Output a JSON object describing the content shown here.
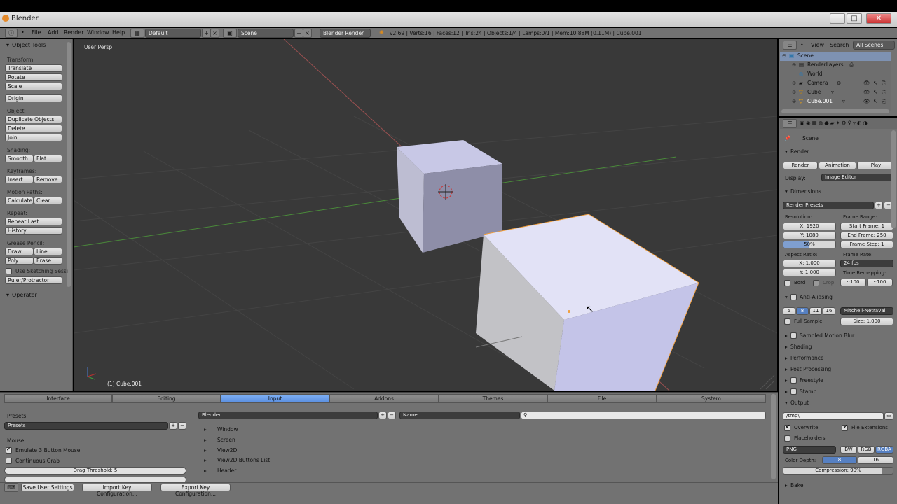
{
  "window": {
    "title": "Blender",
    "minimize": "─",
    "maximize": "□",
    "close": "✕"
  },
  "menubar": {
    "items": [
      "File",
      "Add",
      "Render",
      "Window",
      "Help"
    ],
    "layout": "Default",
    "scene": "Scene",
    "engine": "Blender Render",
    "stats": "v2.69 | Verts:16 | Faces:12 | Tris:24 | Objects:1/4 | Lamps:0/1 | Mem:10.88M (0.11M) | Cube.001"
  },
  "toolbar": {
    "panel_title": "Object Tools",
    "transform_label": "Transform:",
    "translate": "Translate",
    "rotate": "Rotate",
    "scale": "Scale",
    "origin": "Origin",
    "object_label": "Object:",
    "duplicate": "Duplicate Objects",
    "delete": "Delete",
    "join": "Join",
    "shading_label": "Shading:",
    "smooth": "Smooth",
    "flat": "Flat",
    "keyframes_label": "Keyframes:",
    "insert": "Insert",
    "remove": "Remove",
    "motion_label": "Motion Paths:",
    "calculate": "Calculate",
    "clear": "Clear",
    "repeat_label": "Repeat:",
    "repeat_last": "Repeat Last",
    "history": "History...",
    "grease_label": "Grease Pencil:",
    "draw": "Draw",
    "line": "Line",
    "poly": "Poly",
    "erase": "Erase",
    "use_sketching": "Use Sketching Sessi",
    "ruler": "Ruler/Protractor",
    "operator": "Operator"
  },
  "viewport": {
    "view_label": "User Persp",
    "object_label": "(1) Cube.001"
  },
  "outliner": {
    "view": "View",
    "search": "Search",
    "filter": "All Scenes",
    "items": [
      "Scene",
      "RenderLayers",
      "World",
      "Camera",
      "Cube",
      "Cube.001"
    ]
  },
  "properties": {
    "context": "Scene",
    "render_title": "Render",
    "render_btn": "Render",
    "animation_btn": "Animation",
    "play_btn": "Play",
    "display_label": "Display:",
    "display_value": "Image Editor",
    "dimensions_title": "Dimensions",
    "presets": "Render Presets",
    "resolution_label": "Resolution:",
    "res_x": "X: 1920",
    "res_y": "Y: 1080",
    "res_pct": "50%",
    "frame_range_label": "Frame Range:",
    "start_frame": "Start Frame: 1",
    "end_frame": "End Frame: 250",
    "frame_step": "Frame Step: 1",
    "aspect_label": "Aspect Ratio:",
    "aspect_x": "X: 1.000",
    "aspect_y": "Y: 1.000",
    "frame_rate_label": "Frame Rate:",
    "frame_rate": "24 fps",
    "time_remap_label": "Time Remapping:",
    "remap_old": "·:100",
    "remap_new": "·:100",
    "bord": "Bord",
    "crop": "Crop",
    "aa_title": "Anti-Aliasing",
    "aa_samples": [
      "5",
      "8",
      "11",
      "16"
    ],
    "aa_filter": "Mitchell-Netravali",
    "full_sample": "Full Sample",
    "aa_size": "Size: 1.000",
    "sampled_motion_blur": "Sampled Motion Blur",
    "shading": "Shading",
    "performance": "Performance",
    "post_processing": "Post Processing",
    "freestyle": "Freestyle",
    "stamp": "Stamp",
    "output_title": "Output",
    "output_path": "/tmp\\",
    "overwrite": "Overwrite",
    "file_extensions": "File Extensions",
    "placeholders": "Placeholders",
    "format": "PNG",
    "bw": "BW",
    "rgb": "RGB",
    "rgba": "RGBA",
    "color_depth_label": "Color Depth:",
    "depth_8": "8",
    "depth_16": "16",
    "compression": "Compression: 90%",
    "bake": "Bake"
  },
  "prefs": {
    "tabs": [
      "Interface",
      "Editing",
      "Input",
      "Addons",
      "Themes",
      "File",
      "System"
    ],
    "active_tab": "Input",
    "presets_label": "Presets:",
    "presets_value": "Presets",
    "mouse_label": "Mouse:",
    "emulate_3button": "Emulate 3 Button Mouse",
    "continuous_grab": "Continuous Grab",
    "drag_threshold": "Drag Threshold: 5",
    "keymap_selector": "Blender",
    "name_filter": "Name",
    "keymap_items": [
      "Window",
      "Screen",
      "View2D",
      "View2D Buttons List",
      "Header"
    ],
    "save_settings": "Save User Settings",
    "import_key": "Import Key Configuration...",
    "export_key": "Export Key Configuration..."
  }
}
